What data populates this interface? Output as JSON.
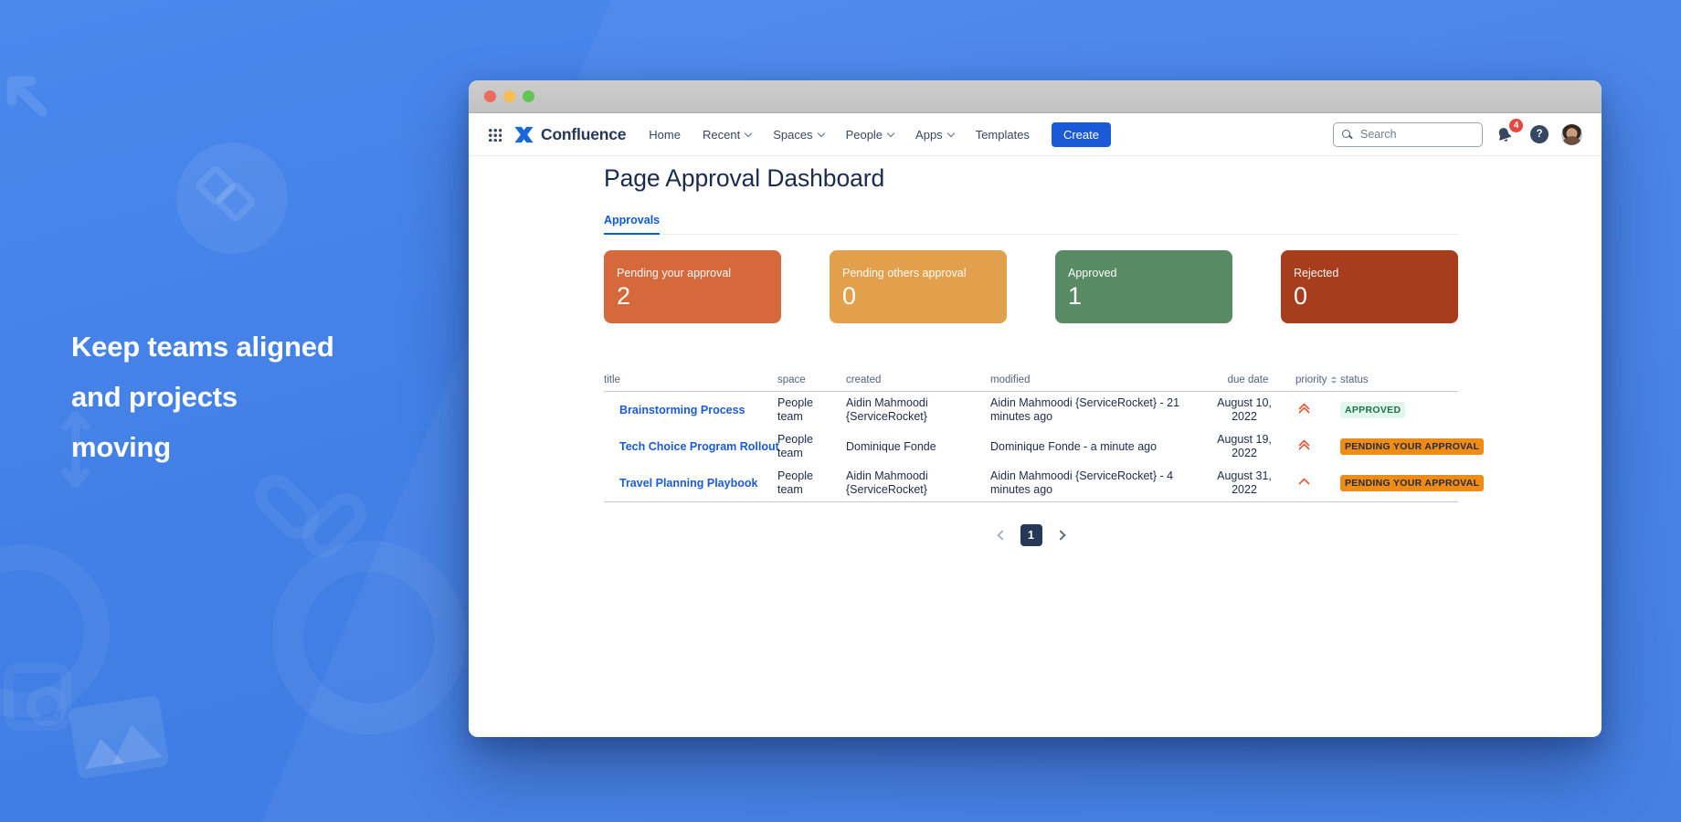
{
  "backdrop": {
    "headline_lines": [
      "Keep teams aligned",
      "and projects",
      "moving"
    ]
  },
  "nav": {
    "logo_text": "Confluence",
    "items": [
      {
        "label": "Home",
        "dropdown": false
      },
      {
        "label": "Recent",
        "dropdown": true
      },
      {
        "label": "Spaces",
        "dropdown": true
      },
      {
        "label": "People",
        "dropdown": true
      },
      {
        "label": "Apps",
        "dropdown": true
      },
      {
        "label": "Templates",
        "dropdown": false
      }
    ],
    "create_label": "Create",
    "search_placeholder": "Search",
    "notification_count": "4",
    "help_label": "?"
  },
  "page": {
    "title": "Page Approval Dashboard",
    "tab": "Approvals"
  },
  "stats": [
    {
      "label": "Pending your approval",
      "value": "2",
      "color": "#D5693C"
    },
    {
      "label": "Pending others approval",
      "value": "0",
      "color": "#E3A04C"
    },
    {
      "label": "Approved",
      "value": "1",
      "color": "#588A64"
    },
    {
      "label": "Rejected",
      "value": "0",
      "color": "#A83D1E"
    }
  ],
  "table": {
    "columns": [
      "title",
      "space",
      "created",
      "modified",
      "due date",
      "priority",
      "status"
    ],
    "rows": [
      {
        "title": "Brainstorming Process",
        "space": "People team",
        "created": "Aidin Mahmoodi {ServiceRocket}",
        "modified": "Aidin Mahmoodi {ServiceRocket} - 21 minutes ago",
        "due_date": "August 10, 2022",
        "priority": "highest",
        "status": "APPROVED"
      },
      {
        "title": "Tech Choice Program Rollout",
        "space": "People team",
        "created": "Dominique Fonde",
        "modified": "Dominique Fonde - a minute ago",
        "due_date": "August 19, 2022",
        "priority": "highest",
        "status": "PENDING YOUR APPROVAL"
      },
      {
        "title": "Travel Planning Playbook",
        "space": "People team",
        "created": "Aidin Mahmoodi {ServiceRocket}",
        "modified": "Aidin Mahmoodi {ServiceRocket} - 4 minutes ago",
        "due_date": "August 31, 2022",
        "priority": "high",
        "status": "PENDING YOUR APPROVAL"
      }
    ]
  },
  "pagination": {
    "current": "1"
  },
  "colors": {
    "background_blue": "#4280E6",
    "brand_blue": "#1868DB",
    "create_button": "#1A5AD6",
    "link_blue": "#1A5BD8",
    "badge_approved_bg": "#E3F8EC",
    "badge_approved_text": "#1F6E4E",
    "badge_pending_bg": "#F08C16",
    "badge_pending_text": "#1D2B48",
    "priority_chevron": "#E65A42",
    "notification_badge": "#E2483D"
  },
  "icons": {
    "app_switcher": "grid-3x3-dots",
    "logo_mark": "confluence-x-mark",
    "search": "magnifier",
    "notifications": "bell",
    "help": "question-mark-circle",
    "priority_highest": "double-chevron-up",
    "priority_high": "chevron-up",
    "sort": "up-down-triangles"
  }
}
